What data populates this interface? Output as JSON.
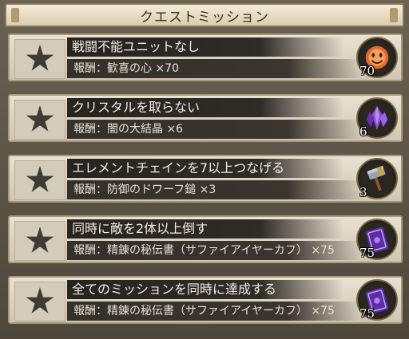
{
  "header": {
    "title": "クエストミッション"
  },
  "missions": [
    {
      "title": "戦闘不能ユニットなし",
      "reward_label": "報酬：",
      "reward_item": "歓喜の心 ×70",
      "count": "70",
      "icon": "joy-heart-icon"
    },
    {
      "title": "クリスタルを取らない",
      "reward_label": "報酬：",
      "reward_item": "闇の大結晶 ×6",
      "count": "6",
      "icon": "dark-crystal-icon"
    },
    {
      "title": "エレメントチェインを7以上つなげる",
      "reward_label": "報酬：",
      "reward_item": "防御のドワーフ鎚 ×3",
      "count": "3",
      "icon": "dwarf-hammer-icon"
    },
    {
      "title": "同時に敵を2体以上倒す",
      "reward_label": "報酬：",
      "reward_item": "精錬の秘伝書（サファイアイヤーカフ） ×75",
      "count": "75",
      "icon": "secret-tome-icon"
    },
    {
      "title": "全てのミッションを同時に達成する",
      "reward_label": "報酬：",
      "reward_item": "精錬の秘伝書（サファイアイヤーカフ） ×75",
      "count": "75",
      "icon": "secret-tome-icon"
    }
  ],
  "colors": {
    "star_incomplete": "#3e3a34",
    "title_bg": "#2f2b26",
    "panel_bg": "#e9e2d3"
  }
}
